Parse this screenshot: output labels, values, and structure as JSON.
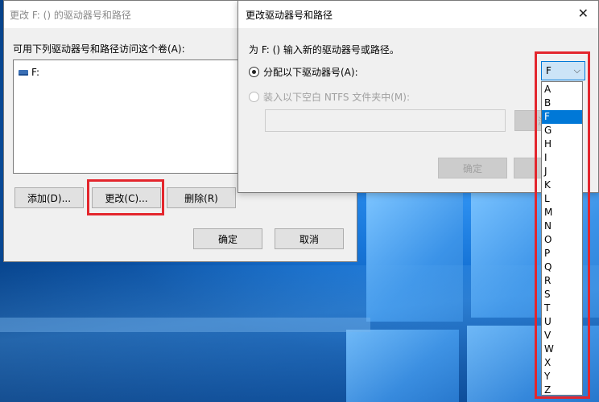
{
  "window1": {
    "title": "更改 F: () 的驱动器号和路径",
    "label": "可用下列驱动器号和路径访问这个卷(A):",
    "list_items": [
      "F:"
    ],
    "buttons": {
      "add": "添加(D)...",
      "change": "更改(C)...",
      "remove": "删除(R)",
      "ok": "确定",
      "cancel": "取消"
    }
  },
  "window2": {
    "title": "更改驱动器号和路径",
    "prompt": "为 F: () 输入新的驱动器号或路径。",
    "option_assign": "分配以下驱动器号(A):",
    "option_mount": "装入以下空白 NTFS 文件夹中(M):",
    "browse_label": "浏",
    "ok": "确定",
    "selected_letter": "F"
  },
  "dropdown_options": [
    "A",
    "B",
    "F",
    "G",
    "H",
    "I",
    "J",
    "K",
    "L",
    "M",
    "N",
    "O",
    "P",
    "Q",
    "R",
    "S",
    "T",
    "U",
    "V",
    "W",
    "X",
    "Y",
    "Z"
  ],
  "colors": {
    "highlight": "#e3262d",
    "selection": "#0078d7"
  }
}
